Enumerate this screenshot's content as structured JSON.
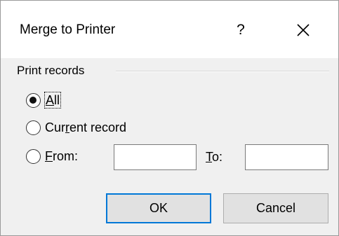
{
  "window": {
    "title": "Merge to Printer",
    "help_label": "?"
  },
  "group": {
    "label": "Print records"
  },
  "options": {
    "all": {
      "label": "All",
      "accel": "A",
      "rest": "ll",
      "checked": true
    },
    "current": {
      "pre": "Cur",
      "accel": "r",
      "post": "ent record",
      "checked": false
    },
    "from": {
      "accel": "F",
      "rest": "rom:",
      "checked": false
    }
  },
  "range": {
    "from_value": "",
    "to_value": "",
    "to_accel": "T",
    "to_rest": "o:"
  },
  "buttons": {
    "ok": "OK",
    "cancel": "Cancel"
  }
}
